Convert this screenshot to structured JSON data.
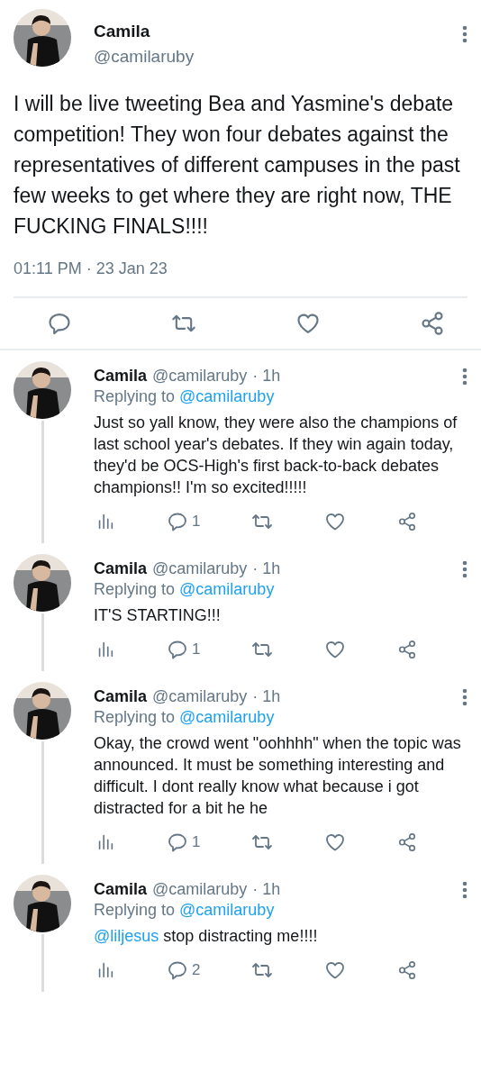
{
  "tweet": {
    "name": "Camila",
    "handle": "@camilaruby",
    "text": "I will be live tweeting Bea and Yasmine's debate competition! They won four debates against the representatives of different campuses in the past few weeks to get where they are right now, THE FUCKING FINALS!!!!",
    "time": "01:11 PM · 23 Jan 23"
  },
  "replies": [
    {
      "name": "Camila",
      "handle": "@camilaruby",
      "age": "· 1h",
      "replying_label": "Replying to",
      "replying_to": "@camilaruby",
      "text": "Just so yall know, they were also the champions of last school year's debates. If they win again today, they'd be OCS-High's first back-to-back debates champions!! I'm so excited!!!!!",
      "reply_count": "1"
    },
    {
      "name": "Camila",
      "handle": "@camilaruby",
      "age": "· 1h",
      "replying_label": "Replying to",
      "replying_to": "@camilaruby",
      "text": "IT'S STARTING!!!",
      "reply_count": "1"
    },
    {
      "name": "Camila",
      "handle": "@camilaruby",
      "age": "· 1h",
      "replying_label": "Replying to",
      "replying_to": "@camilaruby",
      "text": "Okay, the crowd went \"oohhhh\" when the topic was announced. It must be something interesting and difficult. I dont really know what because i got distracted for a bit he he",
      "reply_count": "1"
    },
    {
      "name": "Camila",
      "handle": "@camilaruby",
      "age": "· 1h",
      "replying_label": "Replying to",
      "replying_to": "@camilaruby",
      "mention": "@liljesus",
      "text": "stop distracting me!!!!",
      "reply_count": "2"
    }
  ]
}
